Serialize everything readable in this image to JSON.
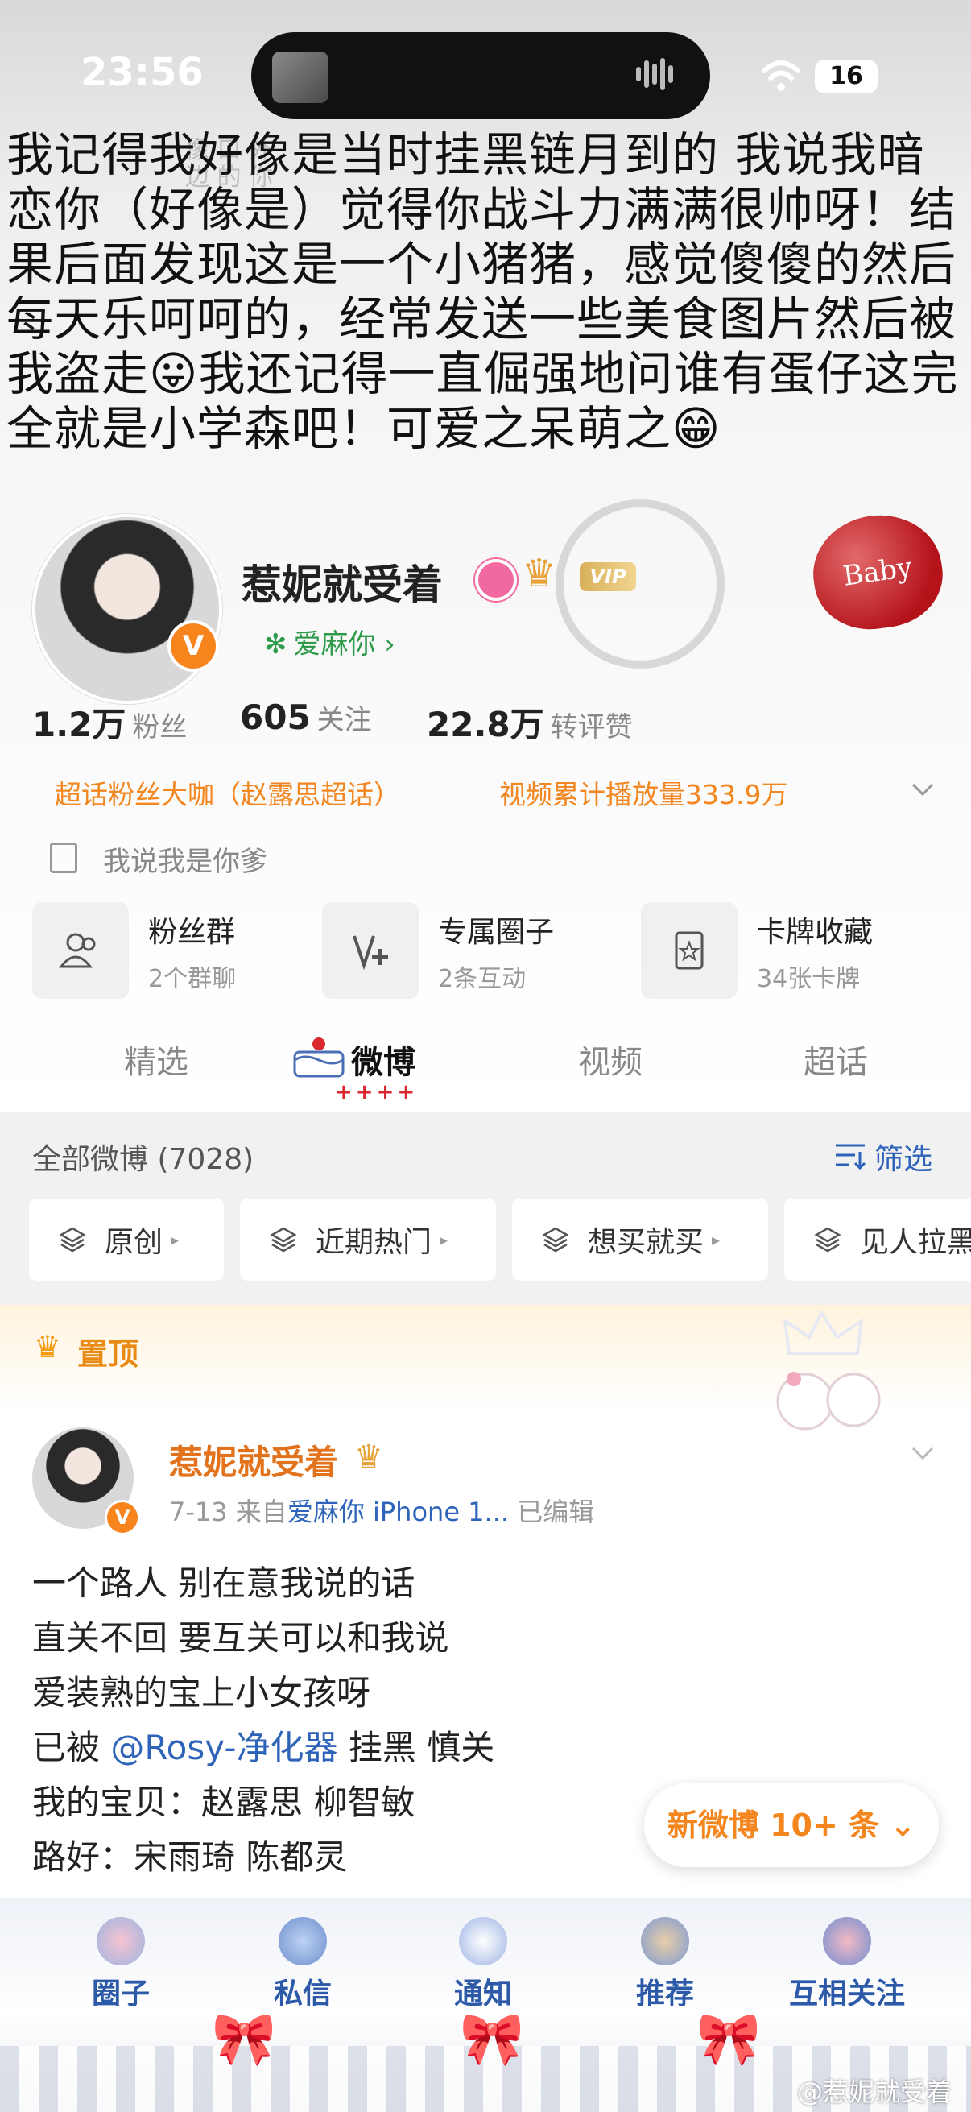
{
  "status_bar": {
    "time": "23:56",
    "battery": "16"
  },
  "caption": "我记得我好像是当时挂黑链月到的 我说我暗恋你（好像是）觉得你战斗力满满很帅呀！结果后面发现这是一个小猪猪，感觉傻傻的然后每天乐呵呵的，经常发送一些美食图片然后被我盗走😛我还记得一直倔强地问谁有蛋仔这完全就是小学森吧！可爱之呆萌之😁",
  "hero": {
    "art_text": "像 口 外 边 的 你",
    "balloon_text": "Baby"
  },
  "profile": {
    "username": "惹妮就受着",
    "vip": "VIP",
    "super_tag": "爱麻你 ›",
    "stats": [
      {
        "value": "1.2万",
        "label": "粉丝"
      },
      {
        "value": "605",
        "label": "关注"
      },
      {
        "value": "22.8万",
        "label": "转评赞"
      }
    ],
    "badges": [
      "超话粉丝大咖（赵露思超话）",
      "视频累计播放量333.9万"
    ],
    "bio": "我说我是你爹",
    "features": [
      {
        "title": "粉丝群",
        "sub": "2个群聊"
      },
      {
        "title": "专属圈子",
        "sub": "2条互动"
      },
      {
        "title": "卡牌收藏",
        "sub": "34张卡牌"
      }
    ]
  },
  "tabs": [
    "精选",
    "微博",
    "视频",
    "超话"
  ],
  "tab_deco": "++++",
  "filter": {
    "all_weibo": "全部微博 (7028)",
    "filter_label": "筛选",
    "chips": [
      "原创",
      "近期热门",
      "想买就买",
      "见人拉黑"
    ]
  },
  "pinned": {
    "label": "置顶",
    "author": "惹妮就受着",
    "date": "7-13",
    "source_prefix": "来自",
    "source": "爱麻你 iPhone 1...",
    "edited": "已编辑",
    "lines": [
      "一个路人 别在意我说的话",
      "直关不回  要互关可以和我说",
      "爱装熟的宝上小女孩呀"
    ],
    "line4_pre": "已被 ",
    "line4_mention": "@Rosy-净化器",
    "line4_post": " 挂黑 慎关",
    "lines_after": [
      "我的宝贝：赵露思  柳智敏",
      "路好：宋雨琦  陈都灵"
    ]
  },
  "new_weibo": "新微博 10+ 条 ⌄",
  "bottom_nav": [
    "圈子",
    "私信",
    "通知",
    "推荐",
    "互相关注"
  ],
  "watermark": "@惹妮就受着",
  "colors": {
    "orange": "#f3861f",
    "blue": "#2d63b8",
    "green": "#2e9a4a"
  }
}
